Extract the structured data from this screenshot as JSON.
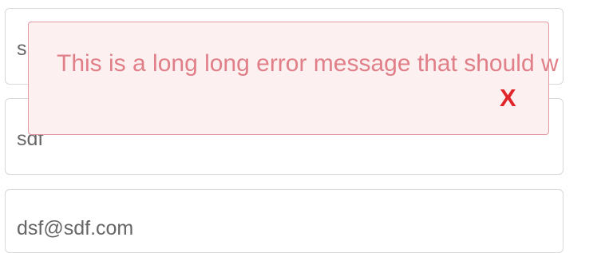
{
  "form": {
    "fields": [
      {
        "value": "s"
      },
      {
        "value": "sdf"
      },
      {
        "value": "dsf@sdf.com"
      }
    ]
  },
  "error_toast": {
    "message": "This is a long long error message that should w",
    "close_label": "X"
  },
  "colors": {
    "error_text": "#e07f88",
    "error_background": "#fdf0f0",
    "error_border": "#e39aa2",
    "close_icon": "#e0262a",
    "field_border": "#d8d8d8",
    "field_text": "#666666"
  }
}
